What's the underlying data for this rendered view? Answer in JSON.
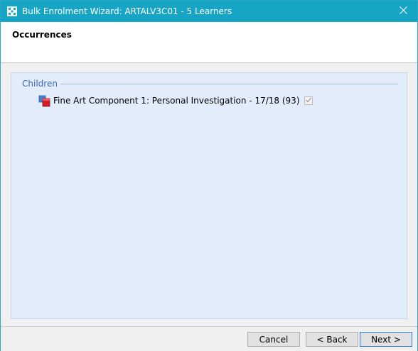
{
  "window": {
    "title": "Bulk Enrolment Wizard: ARTALV3C01 - 5 Learners"
  },
  "header": {
    "title": "Occurrences"
  },
  "group": {
    "title": "Children"
  },
  "item": {
    "label": "Fine Art Component 1: Personal Investigation - 17/18 (93)",
    "checked": true
  },
  "footer": {
    "cancel_label": "Cancel",
    "back_label": "< Back",
    "next_label": "Next >"
  },
  "colors": {
    "titlebar": "#17a5c6",
    "content_bg": "#e2ecfa",
    "group_title": "#3c67b4"
  }
}
